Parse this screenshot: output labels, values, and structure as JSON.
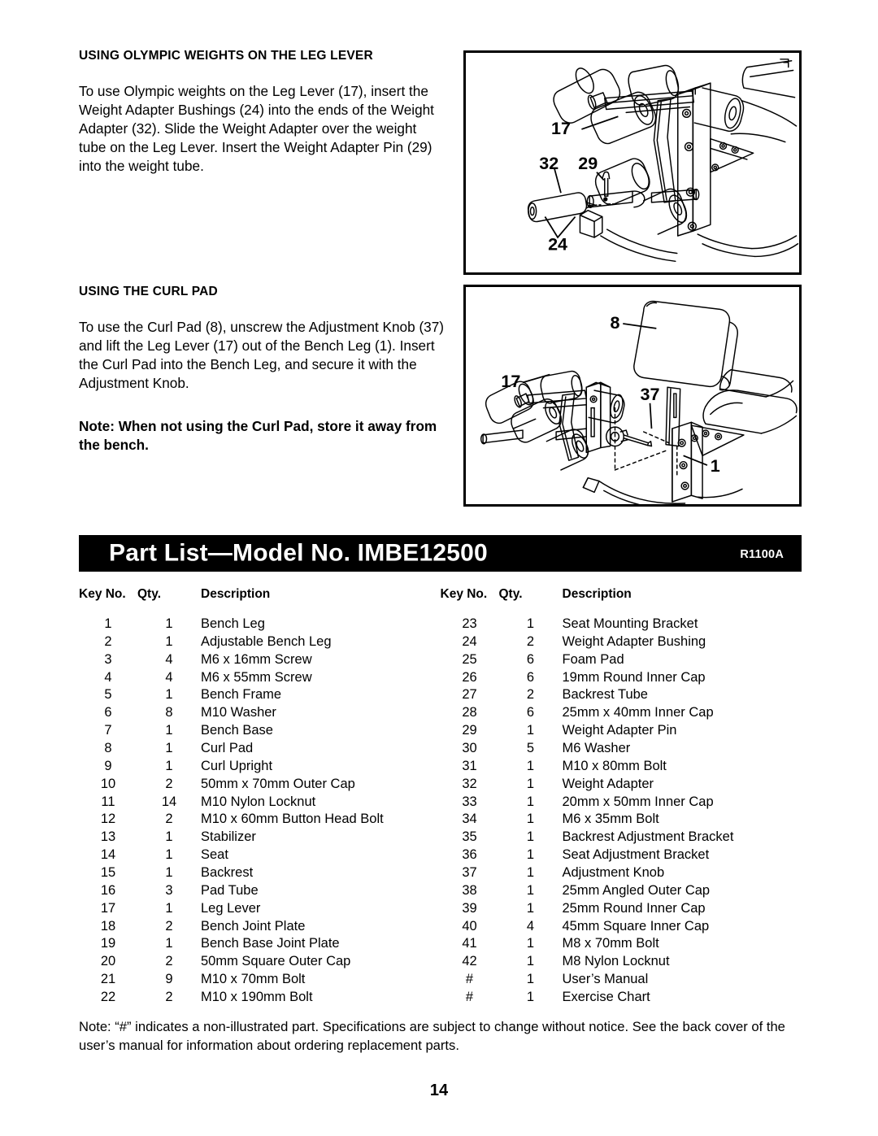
{
  "document": {
    "page_number": "14"
  },
  "sections": [
    {
      "heading": "USING OLYMPIC WEIGHTS ON THE LEG LEVER",
      "body": "To use Olympic weights on the Leg Lever (17), insert the Weight Adapter Bushings (24) into the ends of the Weight Adapter (32). Slide the Weight Adapter over the weight tube on the Leg Lever. Insert the Weight Adapter Pin (29) into the weight tube."
    },
    {
      "heading": "USING THE CURL PAD",
      "body": "To use the Curl Pad (8), unscrew the Adjustment Knob (37) and lift the Leg Lever (17) out of the Bench Leg (1). Insert the Curl Pad into the Bench Leg, and secure it with the Adjustment Knob.",
      "note": "Note: When not using the Curl Pad, store it away from the bench."
    }
  ],
  "illustrations": [
    {
      "name": "leg-lever-weight-adapter-diagram",
      "callouts": [
        "17",
        "32",
        "29",
        "24"
      ]
    },
    {
      "name": "curl-pad-installation-diagram",
      "callouts": [
        "8",
        "17",
        "37",
        "1"
      ]
    }
  ],
  "part_list": {
    "banner_title": "Part List—Model No. IMBE12500",
    "revision_code": "R1100A",
    "columns": [
      "Key No.",
      "Qty.",
      "Description"
    ],
    "left_rows": [
      [
        "1",
        "1",
        "Bench Leg"
      ],
      [
        "2",
        "1",
        "Adjustable Bench Leg"
      ],
      [
        "3",
        "4",
        "M6 x 16mm Screw"
      ],
      [
        "4",
        "4",
        "M6 x 55mm Screw"
      ],
      [
        "5",
        "1",
        "Bench Frame"
      ],
      [
        "6",
        "8",
        "M10 Washer"
      ],
      [
        "7",
        "1",
        "Bench Base"
      ],
      [
        "8",
        "1",
        "Curl Pad"
      ],
      [
        "9",
        "1",
        "Curl Upright"
      ],
      [
        "10",
        "2",
        "50mm x 70mm Outer Cap"
      ],
      [
        "11",
        "14",
        "M10 Nylon Locknut"
      ],
      [
        "12",
        "2",
        "M10 x 60mm Button Head Bolt"
      ],
      [
        "13",
        "1",
        "Stabilizer"
      ],
      [
        "14",
        "1",
        "Seat"
      ],
      [
        "15",
        "1",
        "Backrest"
      ],
      [
        "16",
        "3",
        "Pad Tube"
      ],
      [
        "17",
        "1",
        "Leg Lever"
      ],
      [
        "18",
        "2",
        "Bench Joint Plate"
      ],
      [
        "19",
        "1",
        "Bench Base Joint Plate"
      ],
      [
        "20",
        "2",
        "50mm Square Outer Cap"
      ],
      [
        "21",
        "9",
        "M10 x 70mm Bolt"
      ],
      [
        "22",
        "2",
        "M10 x 190mm Bolt"
      ]
    ],
    "right_rows": [
      [
        "23",
        "1",
        "Seat Mounting Bracket"
      ],
      [
        "24",
        "2",
        "Weight Adapter Bushing"
      ],
      [
        "25",
        "6",
        "Foam Pad"
      ],
      [
        "26",
        "6",
        "19mm Round Inner Cap"
      ],
      [
        "27",
        "2",
        "Backrest Tube"
      ],
      [
        "28",
        "6",
        "25mm x 40mm Inner Cap"
      ],
      [
        "29",
        "1",
        "Weight Adapter Pin"
      ],
      [
        "30",
        "5",
        "M6 Washer"
      ],
      [
        "31",
        "1",
        "M10 x 80mm Bolt"
      ],
      [
        "32",
        "1",
        "Weight Adapter"
      ],
      [
        "33",
        "1",
        "20mm x 50mm Inner Cap"
      ],
      [
        "34",
        "1",
        "M6 x 35mm Bolt"
      ],
      [
        "35",
        "1",
        "Backrest Adjustment Bracket"
      ],
      [
        "36",
        "1",
        "Seat Adjustment Bracket"
      ],
      [
        "37",
        "1",
        "Adjustment Knob"
      ],
      [
        "38",
        "1",
        "25mm Angled Outer Cap"
      ],
      [
        "39",
        "1",
        "25mm Round Inner Cap"
      ],
      [
        "40",
        "4",
        "45mm Square Inner Cap"
      ],
      [
        "41",
        "1",
        "M8 x 70mm Bolt"
      ],
      [
        "42",
        "1",
        "M8 Nylon Locknut"
      ],
      [
        "#",
        "1",
        "User’s Manual"
      ],
      [
        "#",
        "1",
        "Exercise Chart"
      ]
    ],
    "footnote": "Note: “#” indicates a non-illustrated part. Specifications are subject to change without notice. See the back cover of the user’s manual for information about ordering replacement parts."
  }
}
